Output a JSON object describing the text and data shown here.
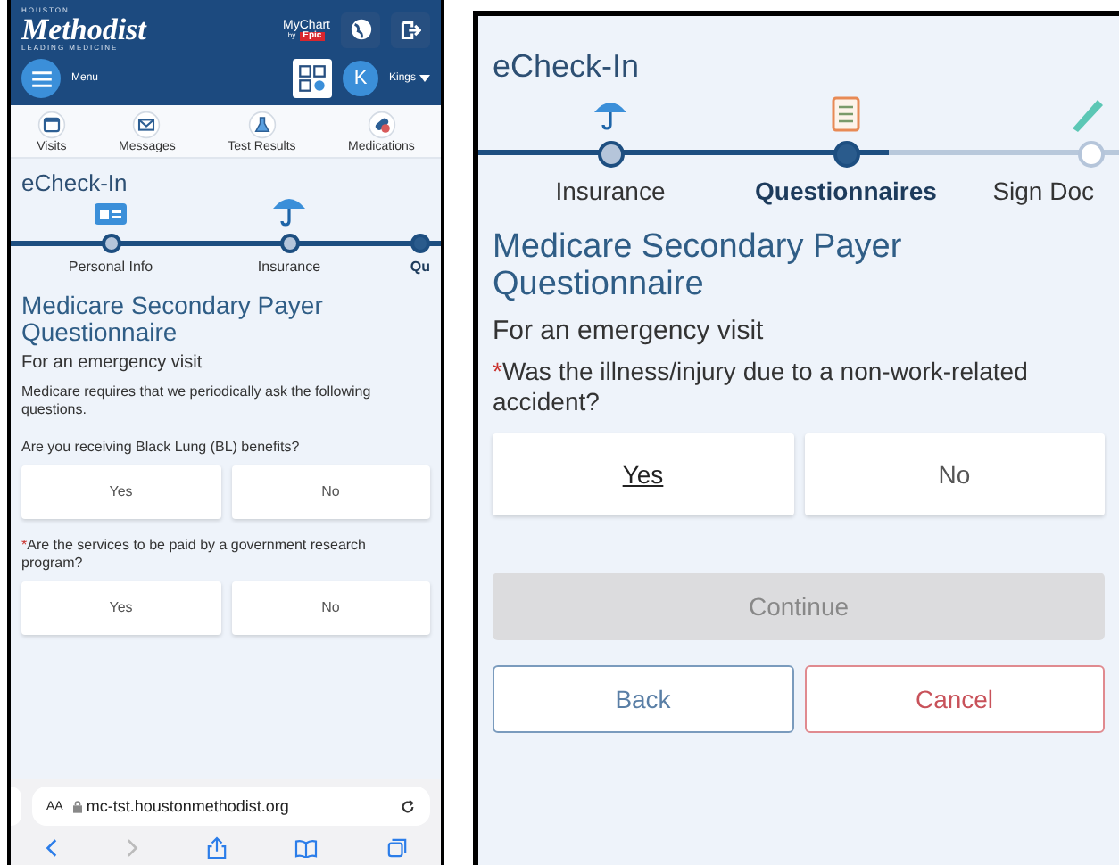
{
  "left_phone": {
    "header": {
      "logo": {
        "top": "HOUSTON",
        "name": "Methodist",
        "tagline": "LEADING MEDICINE"
      },
      "mychart_logo": {
        "name": "MyChart",
        "by": "by",
        "brand": "Epic"
      },
      "menu_label": "Menu",
      "avatar": "K",
      "user": "Kings"
    },
    "nav": [
      {
        "kind": "visits",
        "label": "Visits"
      },
      {
        "kind": "messages",
        "label": "Messages"
      },
      {
        "kind": "test-results",
        "label": "Test Results"
      },
      {
        "kind": "medications",
        "label": "Medications"
      }
    ],
    "page": {
      "title": "eCheck-In",
      "steps": [
        {
          "kind": "personal-info",
          "label": "Personal Info",
          "done": true,
          "selected": false
        },
        {
          "kind": "insurance",
          "label": "Insurance",
          "done": true,
          "selected": false
        },
        {
          "label": "Qu",
          "done": false,
          "selected": true
        }
      ],
      "heading": "Medicare Secondary Payer Questionnaire",
      "subheading": "For an emergency visit",
      "intro": "Medicare requires that we periodically ask the following questions.",
      "questions": [
        {
          "text": "Are you receiving Black Lung (BL) benefits?",
          "answers": [
            {
              "label": "Yes",
              "selected": false
            },
            {
              "label": "No",
              "selected": false
            }
          ]
        },
        {
          "mark": "*",
          "text": "Are the services to be paid by a government research program?",
          "answers": [
            {
              "label": "Yes",
              "selected": false
            },
            {
              "label": "No",
              "selected": false
            }
          ]
        }
      ]
    },
    "browser": {
      "text_size": "AA",
      "url": "mc-tst.houstonmethodist.org"
    }
  },
  "right_phone": {
    "page": {
      "title": "eCheck-In",
      "steps": [
        {
          "kind": "insurance",
          "label": "Insurance",
          "done": true,
          "selected": false
        },
        {
          "kind": "questionnaires",
          "label": "Questionnaires",
          "done": false,
          "selected": true
        },
        {
          "kind": "sign-docs",
          "label": "Sign Doc",
          "done": false,
          "selected": false
        }
      ],
      "heading": "Medicare Secondary Payer Questionnaire",
      "subheading": "For an emergency visit",
      "questions": [
        {
          "mark": "*",
          "text": "Was the illness/injury due to a non-work-related accident?",
          "answers": [
            {
              "label": "Yes",
              "selected": true
            },
            {
              "label": "No",
              "selected": false
            }
          ]
        }
      ],
      "actions": [
        {
          "kind": "primary",
          "label": "Continue",
          "disabled": true
        },
        {
          "kind": "secondary",
          "label": "Back"
        },
        {
          "kind": "danger",
          "label": "Cancel"
        }
      ]
    }
  }
}
